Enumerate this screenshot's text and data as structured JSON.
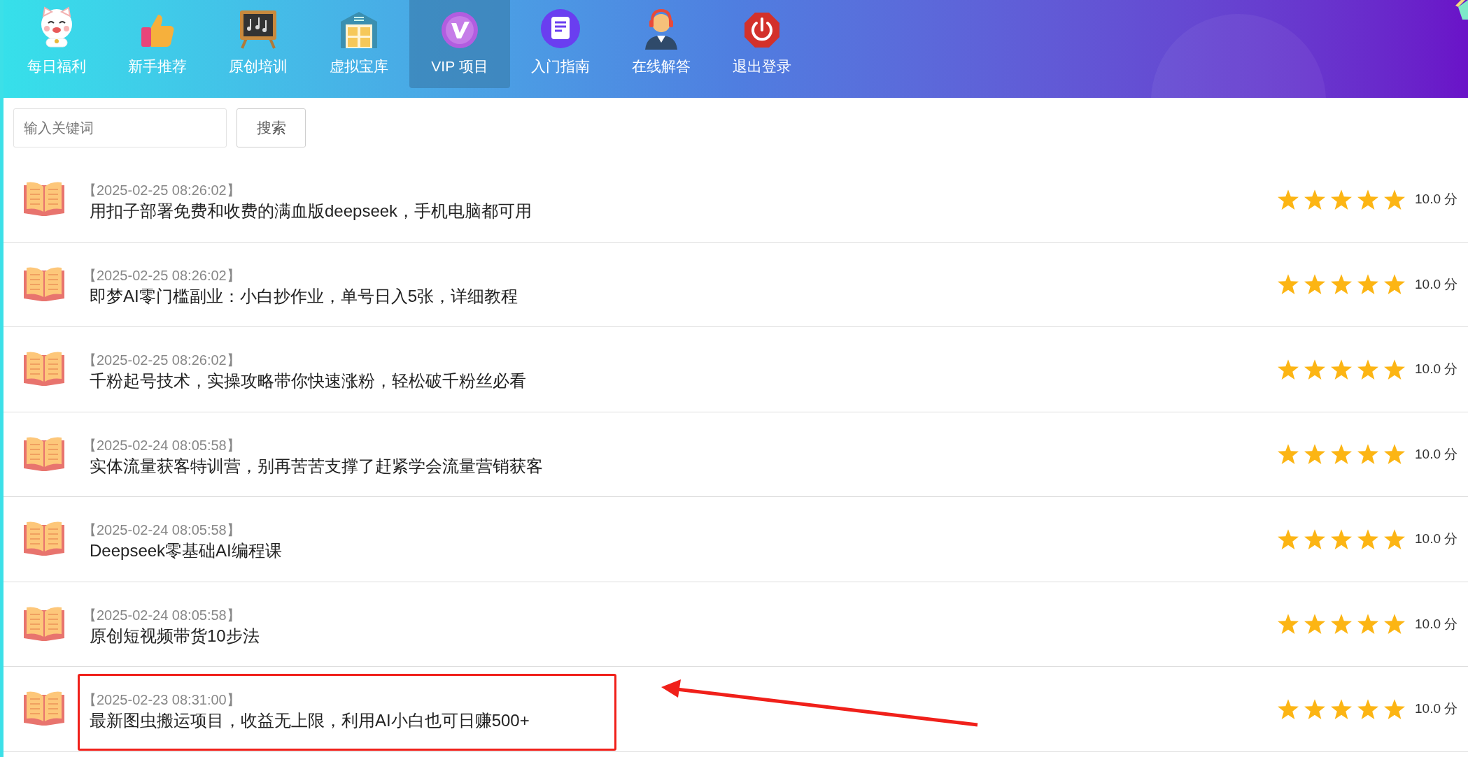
{
  "nav": [
    {
      "label": "每日福利",
      "selected": false
    },
    {
      "label": "新手推荐",
      "selected": false
    },
    {
      "label": "原创培训",
      "selected": false
    },
    {
      "label": "虚拟宝库",
      "selected": false
    },
    {
      "label": "VIP 项目",
      "selected": true
    },
    {
      "label": "入门指南",
      "selected": false
    },
    {
      "label": "在线解答",
      "selected": false
    },
    {
      "label": "退出登录",
      "selected": false
    }
  ],
  "search": {
    "placeholder": "输入关键词",
    "button": "搜索"
  },
  "items": [
    {
      "date": "【2025-02-25 08:26:02】",
      "title": "用扣子部署免费和收费的满血版deepseek，手机电脑都可用",
      "stars": 5,
      "score": "10.0 分",
      "highlighted": false
    },
    {
      "date": "【2025-02-25 08:26:02】",
      "title": "即梦AI零门槛副业：小白抄作业，单号日入5张，详细教程",
      "stars": 5,
      "score": "10.0 分",
      "highlighted": false
    },
    {
      "date": "【2025-02-25 08:26:02】",
      "title": "千粉起号技术，实操攻略带你快速涨粉，轻松破千粉丝必看",
      "stars": 5,
      "score": "10.0 分",
      "highlighted": false
    },
    {
      "date": "【2025-02-24 08:05:58】",
      "title": "实体流量获客特训营，别再苦苦支撑了赶紧学会流量营销获客",
      "stars": 5,
      "score": "10.0 分",
      "highlighted": false
    },
    {
      "date": "【2025-02-24 08:05:58】",
      "title": "Deepseek零基础AI编程课",
      "stars": 5,
      "score": "10.0 分",
      "highlighted": false
    },
    {
      "date": "【2025-02-24 08:05:58】",
      "title": "原创短视频带货10步法",
      "stars": 5,
      "score": "10.0 分",
      "highlighted": false
    },
    {
      "date": "【2025-02-23 08:31:00】",
      "title": "最新图虫搬运项目，收益无上限，利用AI小白也可日赚500+",
      "stars": 5,
      "score": "10.0 分",
      "highlighted": true
    }
  ]
}
